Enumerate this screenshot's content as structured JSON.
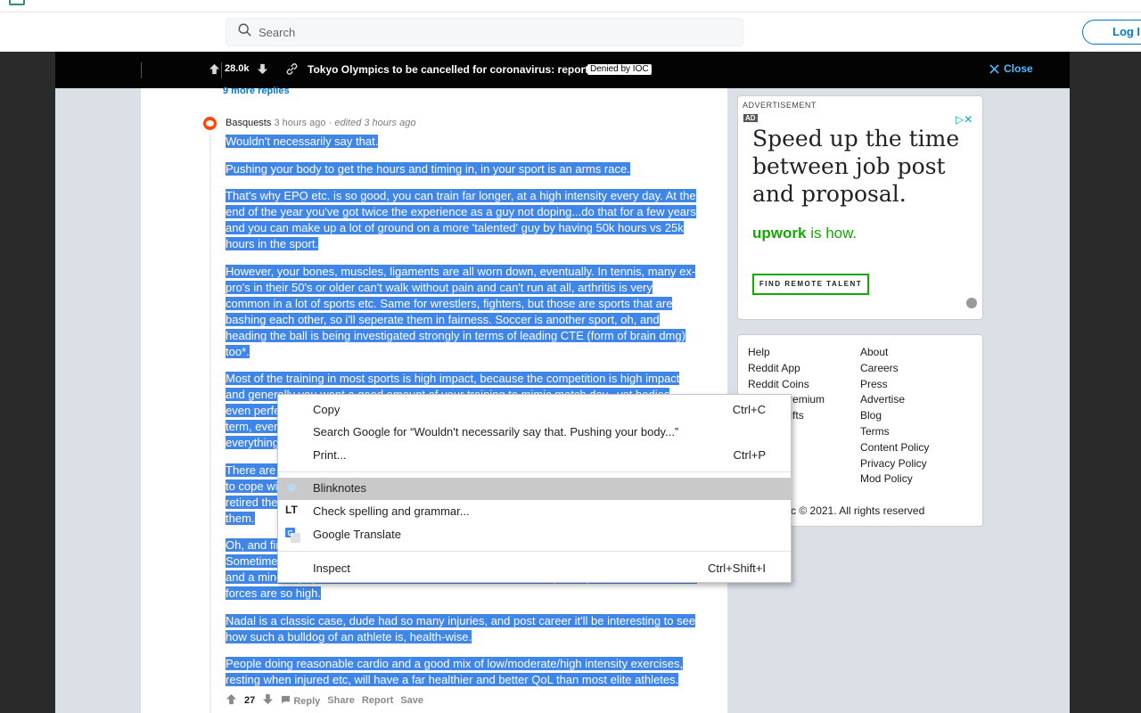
{
  "header": {
    "search_placeholder": "Search",
    "login_label": "Log I"
  },
  "postbar": {
    "score": "28.0k",
    "title": "Tokyo Olympics to be cancelled for coronavirus: report",
    "flair": "Denied by IOC",
    "close_label": "Close"
  },
  "comment": {
    "more_replies": "9 more replies",
    "author": "Basquests",
    "time": "3 hours ago",
    "edited": "edited 3 hours ago",
    "paragraphs": [
      "Wouldn't necessarily say that.",
      "Pushing your body to get the hours and timing in, in your sport is an arms race.",
      "That's why EPO etc. is so good, you can train far longer, at a high intensity every day. At the end of the year you've got twice the experience as a guy not doping...do that for a few years and you can make up a lot of ground on a more 'talented' guy by having 50k hours vs 25k hours in the sport.",
      "However, your bones, muscles, ligaments are all worn down, eventually. In tennis, many ex-pro's in their 50's or older can't walk without pain and can't run at all, arthritis is very common in a lot of sports etc. Same for wrestlers, fighters, but those are sports that are bashing each other, so i'll seperate them in fairness. Soccer is another sport, oh, and heading the ball is being investigated strongly in terms of leading CTE (form of brain dmg) too*.",
      "Most of the training in most sports is high impact, because the competition is high impact and generally you want a good amount of your training to mimic match day...yet bodies even perfectly conditioned aren't designed to take that kind of punishment over the long term, everything wears out eventually and everything comes at a cost in the end, everything.",
      "There are plenty of athletes who have been forced to retire early, or who had to take drugs to cope with the pain just to keep competing at the top level for years, but even once they've retired the damage is done and their bodies have already got a huge amount of wear on them.",
      "Oh, and finally, injuries. Every elite athlete gets injured, and they often push through to. Sometimes they come back too early, sometimes they play through it, and it just pushes on, and a minor injury that should have healed becomes chronic, especially when the amount of forces are so high.",
      "Nadal is a classic case, dude had so many injuries, and post career it'll be interesting to see how such a bulldog of an athlete is, health-wise.",
      "People doing reasonable cardio and a good mix of low/moderate/high intensity exercises, resting when injured etc, will have a far healthier and better QoL than most elite athletes."
    ],
    "score": "27",
    "actions": [
      "Reply",
      "Share",
      "Report",
      "Save"
    ]
  },
  "ad": {
    "label": "ADVERTISEMENT",
    "tag": "AD",
    "headline": "Speed up the time between job post and proposal.",
    "brand": "upwork",
    "brand_tail": "is how.",
    "cta": "FIND REMOTE TALENT"
  },
  "footer": {
    "col1": [
      "Help",
      "Reddit App",
      "Reddit Coins",
      "Reddit Premium",
      "Reddit Gifts"
    ],
    "col2": [
      "About",
      "Careers",
      "Press",
      "Advertise",
      "Blog",
      "Terms",
      "Content Policy",
      "Privacy Policy",
      "Mod Policy"
    ],
    "copyright": "Reddit Inc © 2021. All rights reserved"
  },
  "context_menu": {
    "copy": "Copy",
    "copy_shortcut": "Ctrl+C",
    "search_google": "Search Google for “Wouldn't necessarily say that.  Pushing your body...”",
    "print": "Print...",
    "print_shortcut": "Ctrl+P",
    "blinknotes": "Blinknotes",
    "check_spelling": "Check spelling and grammar...",
    "google_translate": "Google Translate",
    "inspect": "Inspect",
    "inspect_shortcut": "Ctrl+Shift+I"
  }
}
